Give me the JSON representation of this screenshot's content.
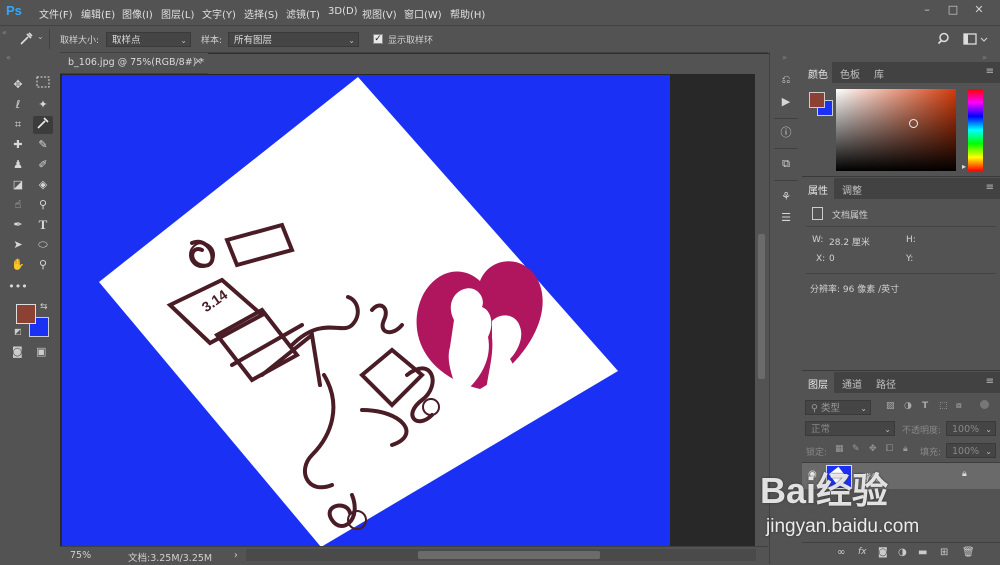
{
  "app": {
    "logo": "Ps"
  },
  "menu": [
    "文件(F)",
    "编辑(E)",
    "图像(I)",
    "图层(L)",
    "文字(Y)",
    "选择(S)",
    "滤镜(T)",
    "3D(D)",
    "视图(V)",
    "窗口(W)",
    "帮助(H)"
  ],
  "window_controls": {
    "minimize": "–",
    "maximize": "□",
    "close": "✕"
  },
  "options": {
    "sample_size_label": "取样大小:",
    "sample_size_value": "取样点",
    "sample_label": "样本:",
    "sample_value": "所有图层",
    "show_ring_label": "显示取样环",
    "show_ring_checked": true
  },
  "document": {
    "tab_title": "b_106.jpg @ 75%(RGB/8#) *",
    "close": "×"
  },
  "status": {
    "zoom": "75%",
    "doc_size": "文档:3.25M/3.25M"
  },
  "image_text": {
    "date": "3.14"
  },
  "colors": {
    "foreground": "#8b4134",
    "background": "#1a31f5",
    "canvas": "#1a31f5"
  },
  "panel_color": {
    "tabs": [
      "颜色",
      "色板",
      "库"
    ],
    "picker_hue": "#d23a0a"
  },
  "panel_properties": {
    "tabs": [
      "属性",
      "调整"
    ],
    "doc_props_label": "文档属性",
    "w_label": "W:",
    "w_value": "28.2 厘米",
    "h_label": "H:",
    "h_value": "",
    "x_label": "X:",
    "x_value": "0",
    "y_label": "Y:",
    "y_value": "",
    "resolution": "分辨率: 96 像素 /英寸"
  },
  "panel_layers": {
    "tabs": [
      "图层",
      "通道",
      "路径"
    ],
    "filter_kind": "类型",
    "blend_mode": "正常",
    "opacity_label": "不透明度:",
    "opacity_value": "100%",
    "lock_label": "锁定:",
    "fill_label": "填充:",
    "fill_value": "100%",
    "layer_name": "背景"
  },
  "watermark": {
    "brand": "Bai经验",
    "url": "jingyan.baidu.com"
  }
}
